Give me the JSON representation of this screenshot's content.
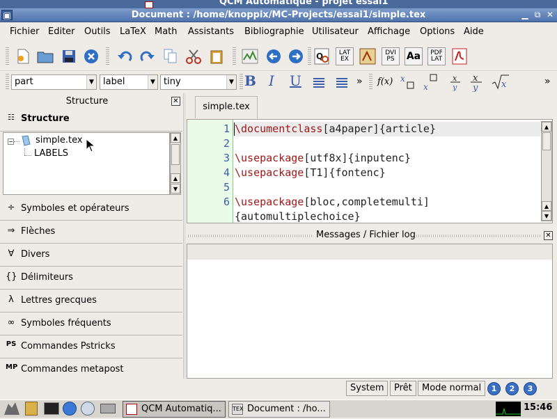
{
  "back_window": {
    "title": "QCM Automatique - projet essai1"
  },
  "window": {
    "title": "Document : /home/knoppix/MC-Projects/essai1/simple.tex"
  },
  "menu": [
    "Fichier",
    "Editer",
    "Outils",
    "LaTeX",
    "Math",
    "Assistants",
    "Bibliographie",
    "Utilisateur",
    "Affichage",
    "Options",
    "Aide"
  ],
  "toolbar2": {
    "combo1": "part",
    "combo2": "label",
    "combo3": "tiny",
    "overflow": "»"
  },
  "toolbar1_labels": {
    "latex": "LAT\nEX",
    "dvips": "DVI\nPS",
    "aa": "Aa",
    "pdflat": "PDF\nLAT"
  },
  "structure": {
    "header": "Structure",
    "title": "Structure",
    "file": "simple.tex",
    "labels": "LABELS",
    "tabs": [
      {
        "icon": "÷",
        "label": "Symboles et opérateurs"
      },
      {
        "icon": "⇒",
        "label": "Flèches"
      },
      {
        "icon": "∀",
        "label": "Divers"
      },
      {
        "icon": "{}",
        "label": "Délimiteurs"
      },
      {
        "icon": "λ",
        "label": "Lettres grecques"
      },
      {
        "icon": "∞",
        "label": "Symboles fréquents"
      },
      {
        "icon": "PS",
        "label": "Commandes Pstricks"
      },
      {
        "icon": "MP",
        "label": "Commandes metapost"
      }
    ]
  },
  "editor": {
    "tab": "simple.tex",
    "lines": [
      {
        "n": "1",
        "kw": "\\documentclass",
        "rest": "[a4paper]{article}"
      },
      {
        "n": "2",
        "kw": "",
        "rest": ""
      },
      {
        "n": "3",
        "kw": "\\usepackage",
        "rest": "[utf8x]{inputenc}"
      },
      {
        "n": "4",
        "kw": "\\usepackage",
        "rest": "[T1]{fontenc}"
      },
      {
        "n": "5",
        "kw": "",
        "rest": ""
      },
      {
        "n": "6",
        "kw": "\\usepackage",
        "rest": "[bloc,completemulti]"
      },
      {
        "n": "",
        "kw": "",
        "rest": "{automultiplechoice}"
      }
    ]
  },
  "messages": {
    "header": "Messages / Fichier log"
  },
  "status": {
    "system": "System",
    "pret": "Prêt",
    "mode": "Mode normal",
    "n1": "1",
    "n2": "2",
    "n3": "3"
  },
  "taskbar": {
    "task1": "QCM Automatiq...",
    "task2": "Document : /ho...",
    "clock": "15:46"
  }
}
